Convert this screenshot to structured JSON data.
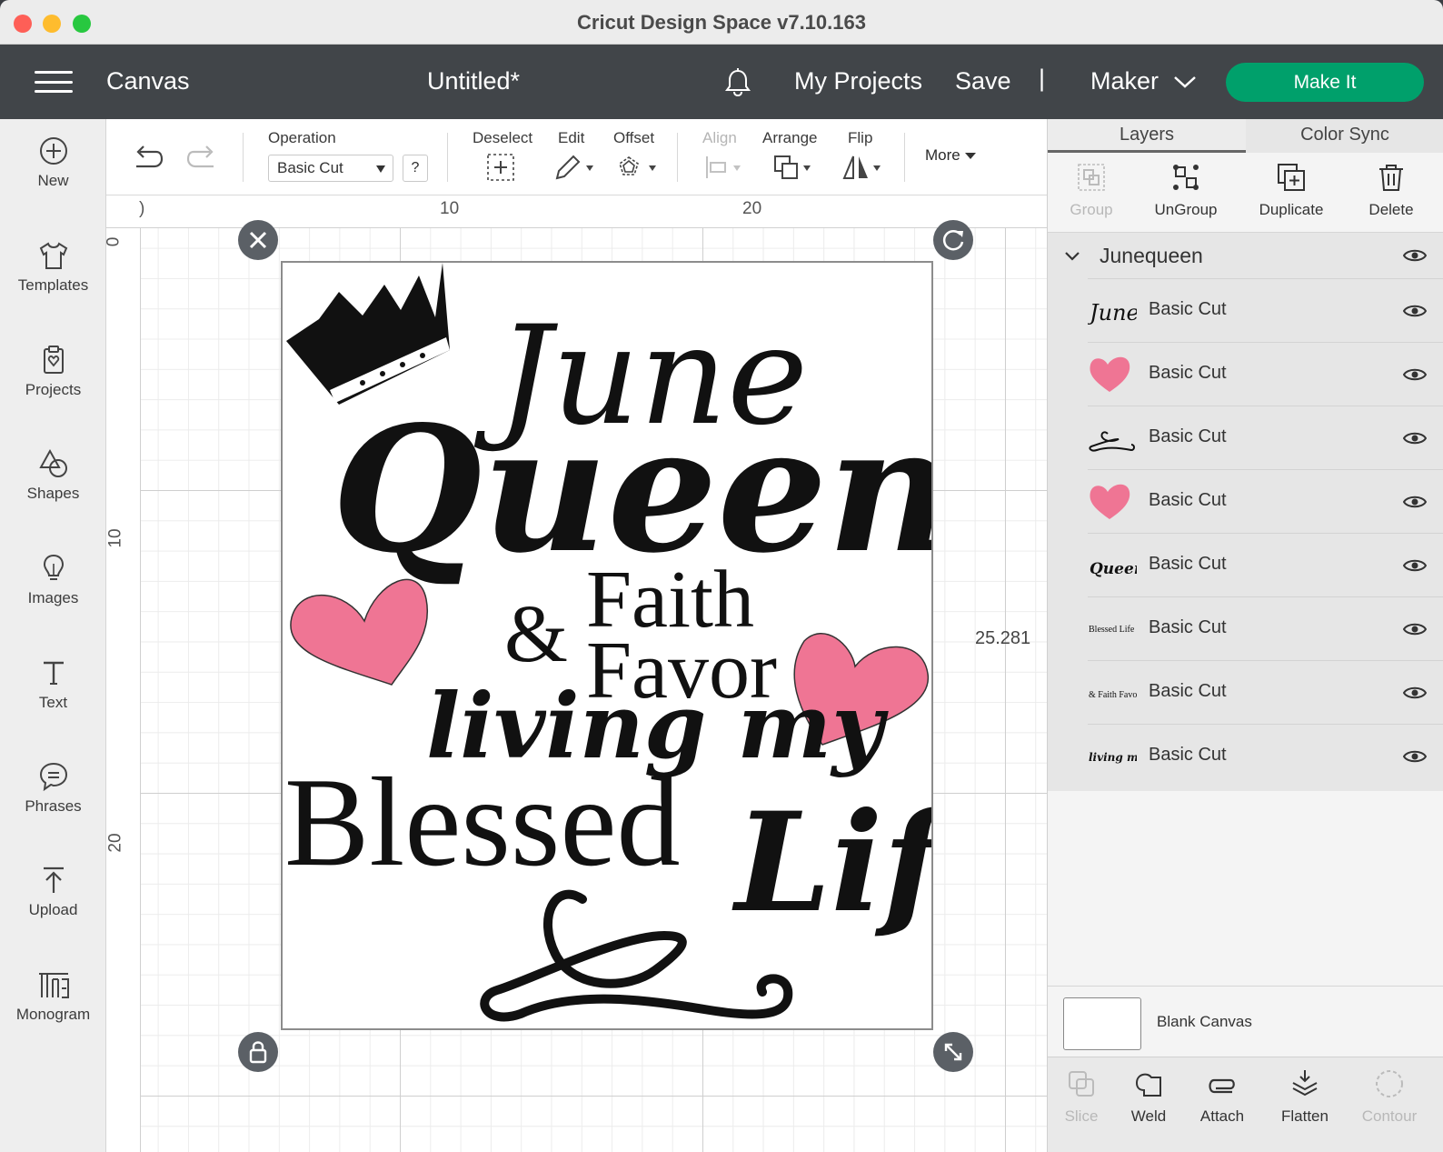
{
  "window": {
    "title": "Cricut Design Space  v7.10.163"
  },
  "header": {
    "canvas_label": "Canvas",
    "project_name": "Untitled*",
    "my_projects": "My Projects",
    "save": "Save",
    "separator": "|",
    "machine": "Maker",
    "make_it": "Make It",
    "accent_color": "#00a06b"
  },
  "sidebar": {
    "items": [
      {
        "label": "New",
        "icon": "plus-circle-icon"
      },
      {
        "label": "Templates",
        "icon": "tshirt-icon"
      },
      {
        "label": "Projects",
        "icon": "projects-icon"
      },
      {
        "label": "Shapes",
        "icon": "shapes-icon"
      },
      {
        "label": "Images",
        "icon": "lightbulb-icon"
      },
      {
        "label": "Text",
        "icon": "text-icon"
      },
      {
        "label": "Phrases",
        "icon": "speech-bubble-icon"
      },
      {
        "label": "Upload",
        "icon": "upload-icon"
      },
      {
        "label": "Monogram",
        "icon": "monogram-icon"
      }
    ]
  },
  "toolbar": {
    "operation_label": "Operation",
    "operation_value": "Basic Cut",
    "help": "?",
    "deselect": "Deselect",
    "edit": "Edit",
    "offset": "Offset",
    "align": "Align",
    "arrange": "Arrange",
    "flip": "Flip",
    "more": "More"
  },
  "canvas": {
    "ruler_top": [
      ")",
      "10",
      "20"
    ],
    "ruler_left": [
      "0",
      "10",
      "20"
    ],
    "height_readout": "25.281",
    "design_text": {
      "line1": "June",
      "line2": "Queen",
      "line3": "Faith",
      "amp": "&",
      "line4": "Favor",
      "line5": "living my",
      "line6": "Blessed",
      "line7": "Life"
    },
    "heart_color": "#ef7594"
  },
  "right_panel": {
    "tabs": [
      "Layers",
      "Color Sync"
    ],
    "actions": [
      {
        "label": "Group",
        "enabled": false
      },
      {
        "label": "UnGroup",
        "enabled": true
      },
      {
        "label": "Duplicate",
        "enabled": true
      },
      {
        "label": "Delete",
        "enabled": true
      }
    ],
    "group_name": "Junequeen",
    "layers": [
      {
        "thumb": "June",
        "name": "Basic Cut"
      },
      {
        "thumb": "heart",
        "name": "Basic Cut"
      },
      {
        "thumb": "flourish",
        "name": "Basic Cut"
      },
      {
        "thumb": "heart",
        "name": "Basic Cut"
      },
      {
        "thumb": "Queen",
        "name": "Basic Cut"
      },
      {
        "thumb": "Blessed Life",
        "name": "Basic Cut"
      },
      {
        "thumb": "& Faith Favor",
        "name": "Basic Cut"
      },
      {
        "thumb": "living my",
        "name": "Basic Cut"
      }
    ],
    "blank_canvas": "Blank Canvas",
    "bottom_actions": [
      {
        "label": "Slice",
        "enabled": false
      },
      {
        "label": "Weld",
        "enabled": true
      },
      {
        "label": "Attach",
        "enabled": true
      },
      {
        "label": "Flatten",
        "enabled": true
      },
      {
        "label": "Contour",
        "enabled": false
      }
    ]
  }
}
